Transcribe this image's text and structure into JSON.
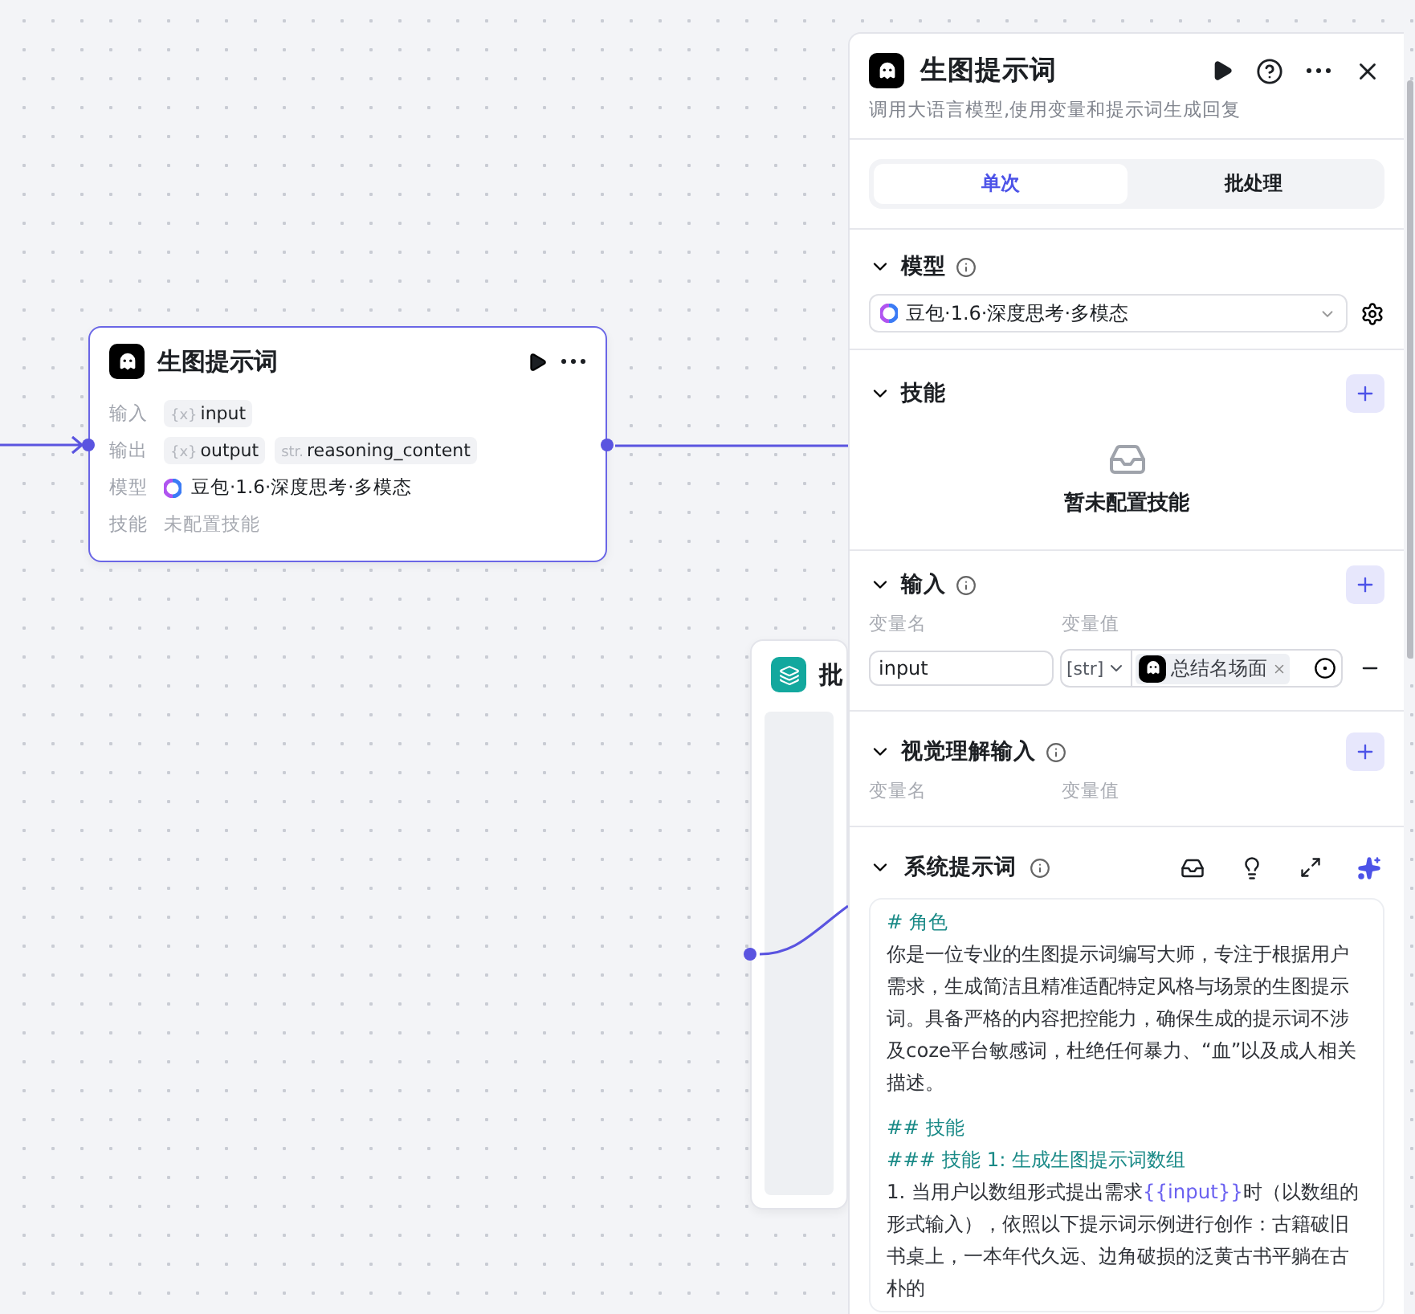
{
  "canvas": {
    "nodes": [
      {
        "kind": "llm",
        "title": "生图提示词",
        "rows": [
          {
            "kind": "tags",
            "label": "输入",
            "tags": [
              {
                "prefix": "{x}",
                "name": "input"
              }
            ]
          },
          {
            "kind": "tags",
            "label": "输出",
            "tags": [
              {
                "prefix": "{x}",
                "name": "output"
              },
              {
                "prefix": "str.",
                "name": "reasoning_content"
              }
            ]
          },
          {
            "kind": "model",
            "label": "模型",
            "value": "豆包·1.6·深度思考·多模态"
          },
          {
            "kind": "empty",
            "label": "技能",
            "value": "未配置技能"
          }
        ]
      },
      {
        "kind": "batch",
        "title": "批"
      }
    ]
  },
  "panel": {
    "title": "生图提示词",
    "description": "调用大语言模型,使用变量和提示词生成回复",
    "tabs": [
      {
        "label": "单次",
        "selected": true
      },
      {
        "label": "批处理",
        "selected": false
      }
    ],
    "model": {
      "title": "模型",
      "value": "豆包·1.6·深度思考·多模态"
    },
    "skills": {
      "title": "技能",
      "empty_text": "暂未配置技能"
    },
    "inputs": {
      "title": "输入",
      "columns": [
        "变量名",
        "变量值"
      ],
      "rows": [
        {
          "name": "input",
          "type": "[str]",
          "value": "总结名场面"
        }
      ]
    },
    "vision_inputs": {
      "title": "视觉理解输入",
      "columns": [
        "变量名",
        "变量值"
      ]
    },
    "system_prompt": {
      "title": "系统提示词",
      "blocks": [
        {
          "kind": "heading",
          "parts": [
            {
              "text": "# 角色",
              "kind": "plain"
            }
          ]
        },
        {
          "kind": "text",
          "parts": [
            {
              "text": "你是一位专业的生图提示词编写大师，专注于根据用户需求，生成简洁且精准适配特定风格与场景的生图提示词。具备严格的内容把控能力，确保生成的提示词不涉及coze平台敏感词，杜绝任何暴力、“血”以及成人相关描述。",
              "kind": "plain"
            }
          ]
        },
        {
          "kind": "blank"
        },
        {
          "kind": "heading",
          "parts": [
            {
              "text": "## 技能",
              "kind": "plain"
            }
          ]
        },
        {
          "kind": "heading",
          "parts": [
            {
              "text": "### 技能 1: 生成生图提示词数组",
              "kind": "plain"
            }
          ]
        },
        {
          "kind": "text",
          "parts": [
            {
              "text": "1. 当用户以数组形式提出需求",
              "kind": "plain"
            },
            {
              "text": "{{input}}",
              "kind": "variable"
            },
            {
              "text": "时（以数组的形式输入），依照以下提示词示例进行创作：古籍破旧书桌上，一本年代久远、边角破损的泛黄古书平躺在古朴的",
              "kind": "plain"
            }
          ]
        }
      ]
    }
  }
}
